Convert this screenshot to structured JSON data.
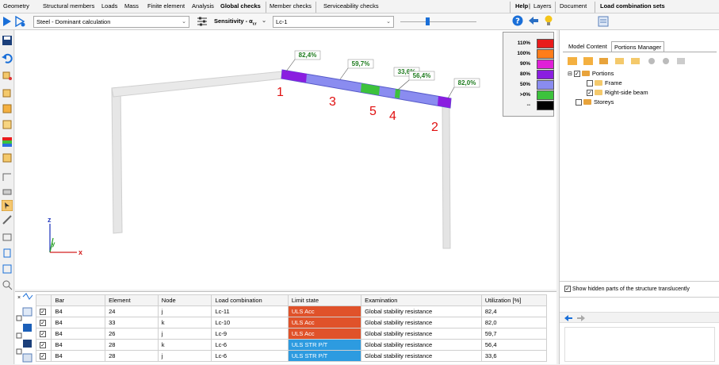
{
  "menubar": {
    "items": [
      "Geometry",
      "Structural members",
      "Loads",
      "Mass",
      "Finite element",
      "Analysis",
      "Global checks",
      "Member checks",
      "Serviceability checks"
    ],
    "right_items": [
      "Help",
      "Layers",
      "Document",
      "Load combination sets"
    ]
  },
  "toolbar": {
    "calc_select": "Steel - Dominant calculation",
    "sensitivity_label": "Sensitivity - α",
    "sensitivity_sub": "cr",
    "combination_select": "Lc-1"
  },
  "viewport": {
    "labels": [
      {
        "value": "82,4%"
      },
      {
        "value": "59,7%"
      },
      {
        "value": "33,6%"
      },
      {
        "value": "56,4%"
      },
      {
        "value": "82,0%"
      }
    ],
    "markers": [
      "1",
      "3",
      "5",
      "4",
      "2"
    ],
    "axes": {
      "z": "z",
      "y": "y",
      "x": "x"
    }
  },
  "legend": {
    "items": [
      {
        "label": "110%",
        "color": "#e81c1c"
      },
      {
        "label": "100%",
        "color": "#ff7d1a"
      },
      {
        "label": "90%",
        "color": "#e020d8"
      },
      {
        "label": "80%",
        "color": "#8a1ee0"
      },
      {
        "label": "50%",
        "color": "#8a8cf0"
      },
      {
        "label": ">0%",
        "color": "#3cc23c"
      },
      {
        "label": "--",
        "color": "#000000"
      }
    ]
  },
  "right_panel": {
    "tabs": [
      "Model Content",
      "Portions Manager"
    ],
    "tree": {
      "root": "Portions",
      "children": [
        "Frame",
        "Right-side beam"
      ],
      "sibling": "Storeys"
    },
    "option_label": "Show hidden parts of the structure translucently"
  },
  "table": {
    "headers": [
      "Bar",
      "Element",
      "Node",
      "Load combination",
      "Limit state",
      "Examination",
      "Utilization [%]"
    ],
    "rows": [
      {
        "bar": "B4",
        "element": "24",
        "node": "j",
        "combination": "Lc-11",
        "limit": "ULS Acc",
        "exam": "Global stability resistance",
        "util": "82,4"
      },
      {
        "bar": "B4",
        "element": "33",
        "node": "k",
        "combination": "Lc-10",
        "limit": "ULS Acc",
        "exam": "Global stability resistance",
        "util": "82,0"
      },
      {
        "bar": "B4",
        "element": "26",
        "node": "j",
        "combination": "Lc-9",
        "limit": "ULS Acc",
        "exam": "Global stability resistance",
        "util": "59,7"
      },
      {
        "bar": "B4",
        "element": "28",
        "node": "k",
        "combination": "Lc-6",
        "limit": "ULS STR P/T",
        "exam": "Global stability resistance",
        "util": "56,4"
      },
      {
        "bar": "B4",
        "element": "28",
        "node": "j",
        "combination": "Lc-6",
        "limit": "ULS STR P/T",
        "exam": "Global stability resistance",
        "util": "33,6"
      }
    ]
  }
}
